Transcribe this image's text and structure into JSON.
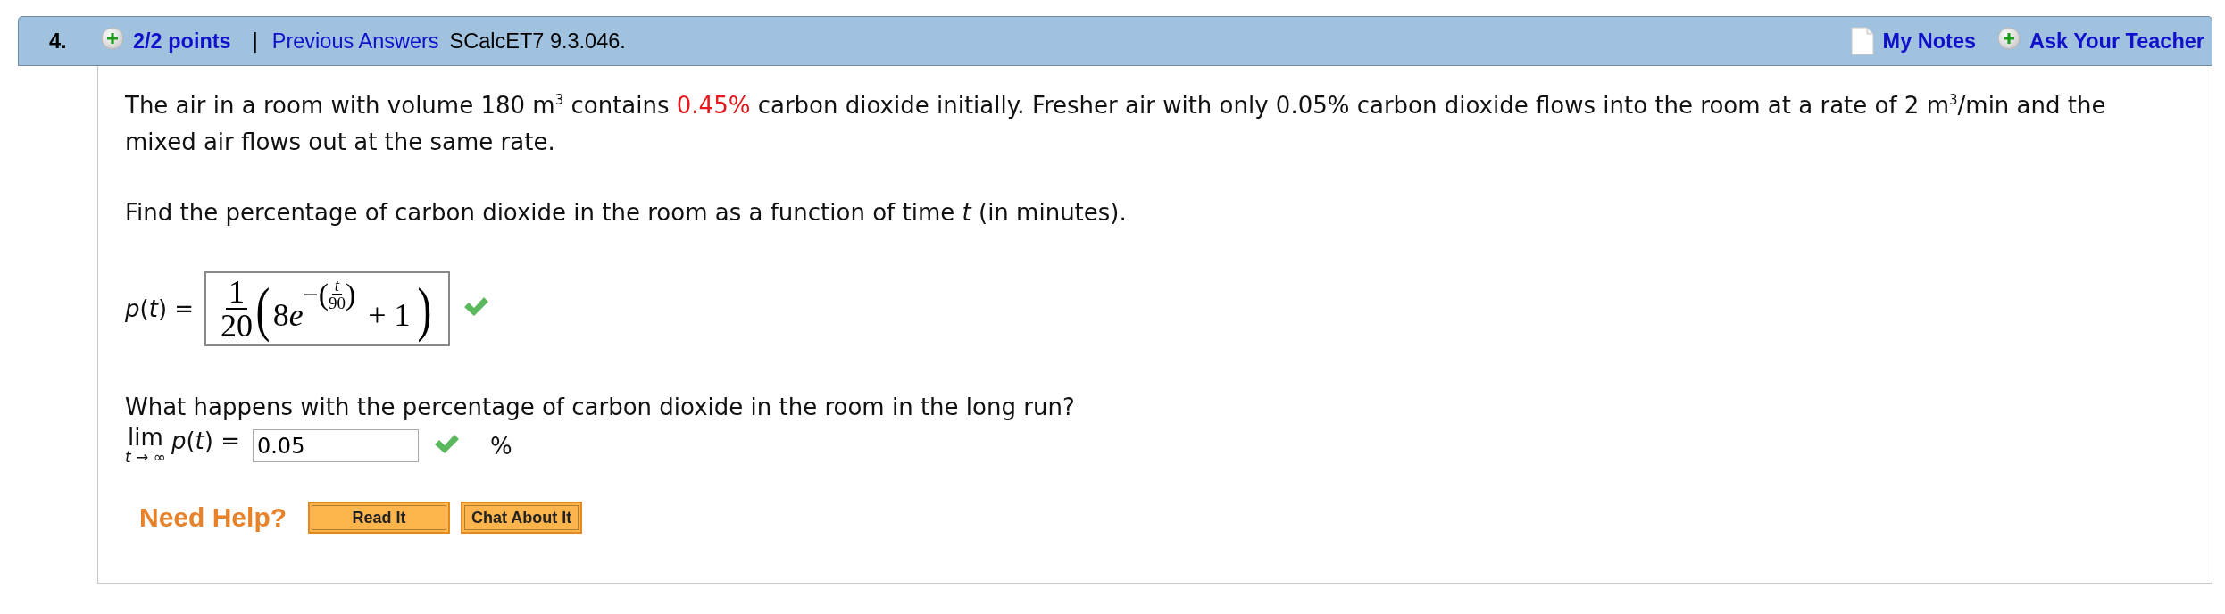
{
  "header": {
    "number": "4.",
    "points": "2/2 points",
    "separator": "|",
    "previous_answers": "Previous Answers",
    "source": "SCalcET7 9.3.046.",
    "my_notes": "My Notes",
    "ask_teacher": "Ask Your Teacher"
  },
  "problem": {
    "intro": [
      {
        "text": "The air in a room with volume 180 m$^{3}$ contains ",
        "highlight": false
      },
      {
        "text": "0.45%",
        "highlight": true
      },
      {
        "text": " carbon dioxide initially. Fresher air with only 0.05% carbon dioxide flows into the room at a rate of 2 m$^{3}$/min and the mixed air flows out at the same rate.",
        "highlight": false
      }
    ],
    "prompt": "Find the percentage of carbon dioxide in the room as a function of time *t* (in minutes).",
    "formula_answer": {
      "label": "*p*(*t*) =",
      "numerator": "1",
      "denominator": "20",
      "open_paren": "(",
      "base_number": "8",
      "base_letter": "e",
      "exponent_sign": "−",
      "exp_open_paren": "(",
      "exp_numerator": "t",
      "exp_denominator": "90",
      "exp_close_paren": ")",
      "tail": "+ 1",
      "close_paren": ")",
      "correct": true
    },
    "limit_prompt": "What happens with the percentage of carbon dioxide in the room in the long run?",
    "limit_answer": {
      "operator": "lim",
      "subscript": "*t* → ∞",
      "label": "*p*(*t*) =",
      "value": "0.05",
      "correct": true,
      "unit": "%"
    }
  },
  "help": {
    "label": "Need Help?",
    "buttons": [
      "Read It",
      "Chat About It"
    ]
  }
}
